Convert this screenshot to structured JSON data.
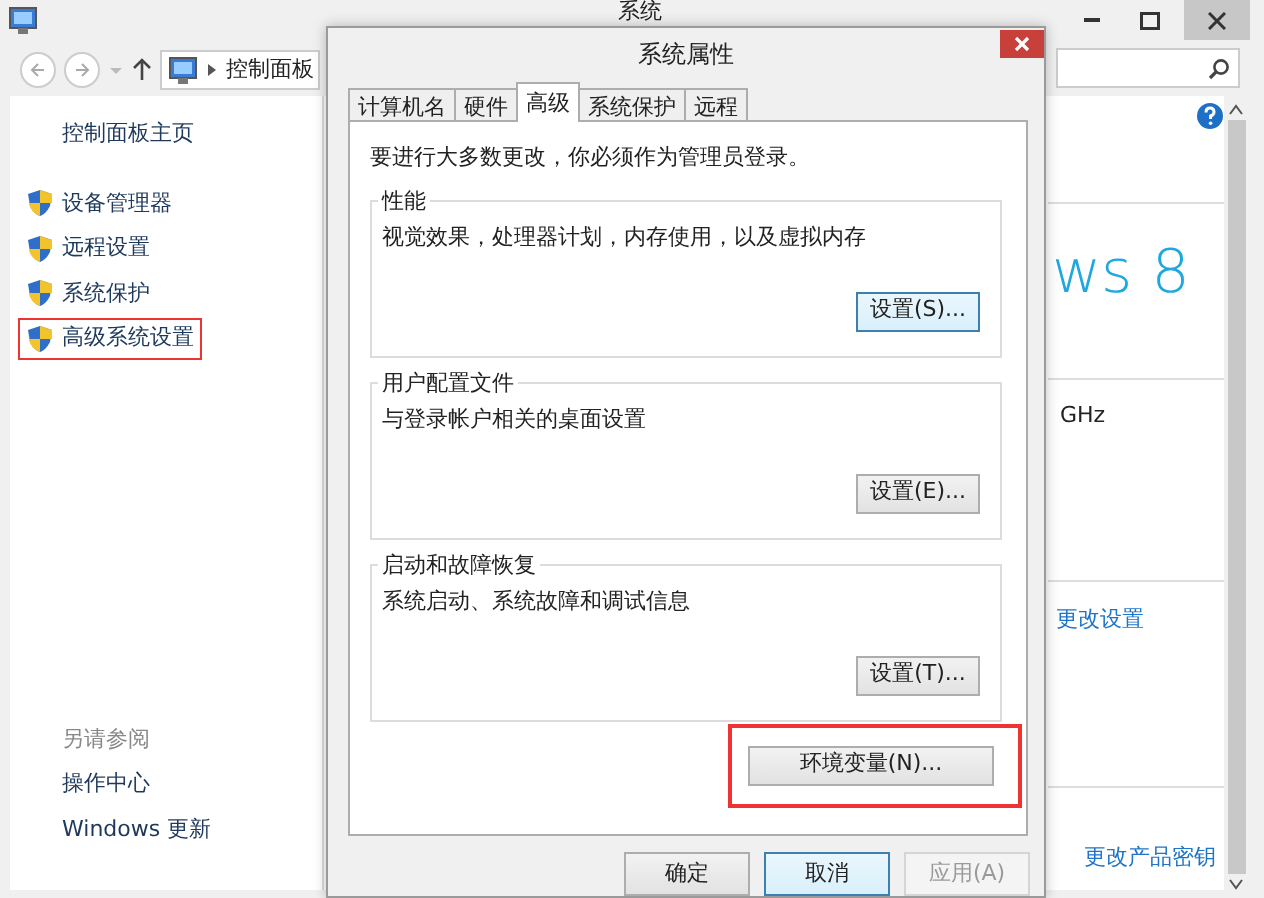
{
  "background_window": {
    "title": "系统",
    "breadcrumb": "控制面板",
    "sidebar": {
      "home": "控制面板主页",
      "items": [
        {
          "label": "设备管理器",
          "highlighted": false
        },
        {
          "label": "远程设置",
          "highlighted": false
        },
        {
          "label": "系统保护",
          "highlighted": false
        },
        {
          "label": "高级系统设置",
          "highlighted": true
        }
      ],
      "see_also_title": "另请参阅",
      "see_also": [
        "操作中心",
        "Windows 更新"
      ]
    },
    "content": {
      "logo": "ws 8",
      "processor_speed": "GHz",
      "change_settings": "更改设置",
      "change_key": "更改产品密钥"
    }
  },
  "dialog": {
    "title": "系统属性",
    "tabs": [
      {
        "label": "计算机名",
        "selected": false
      },
      {
        "label": "硬件",
        "selected": false
      },
      {
        "label": "高级",
        "selected": true
      },
      {
        "label": "系统保护",
        "selected": false
      },
      {
        "label": "远程",
        "selected": false
      }
    ],
    "notice": "要进行大多数更改，你必须作为管理员登录。",
    "groups": [
      {
        "title": "性能",
        "description": "视觉效果，处理器计划，内存使用，以及虚拟内存",
        "button": "设置(S)...",
        "focused": true
      },
      {
        "title": "用户配置文件",
        "description": "与登录帐户相关的桌面设置",
        "button": "设置(E)...",
        "focused": false
      },
      {
        "title": "启动和故障恢复",
        "description": "系统启动、系统故障和调试信息",
        "button": "设置(T)...",
        "focused": false
      }
    ],
    "env_button": {
      "label": "环境变量(N)...",
      "highlighted": true
    },
    "buttons": [
      {
        "label": "确定",
        "disabled": false,
        "focused": false
      },
      {
        "label": "取消",
        "disabled": false,
        "focused": true
      },
      {
        "label": "应用(A)",
        "disabled": true,
        "focused": false
      }
    ]
  }
}
